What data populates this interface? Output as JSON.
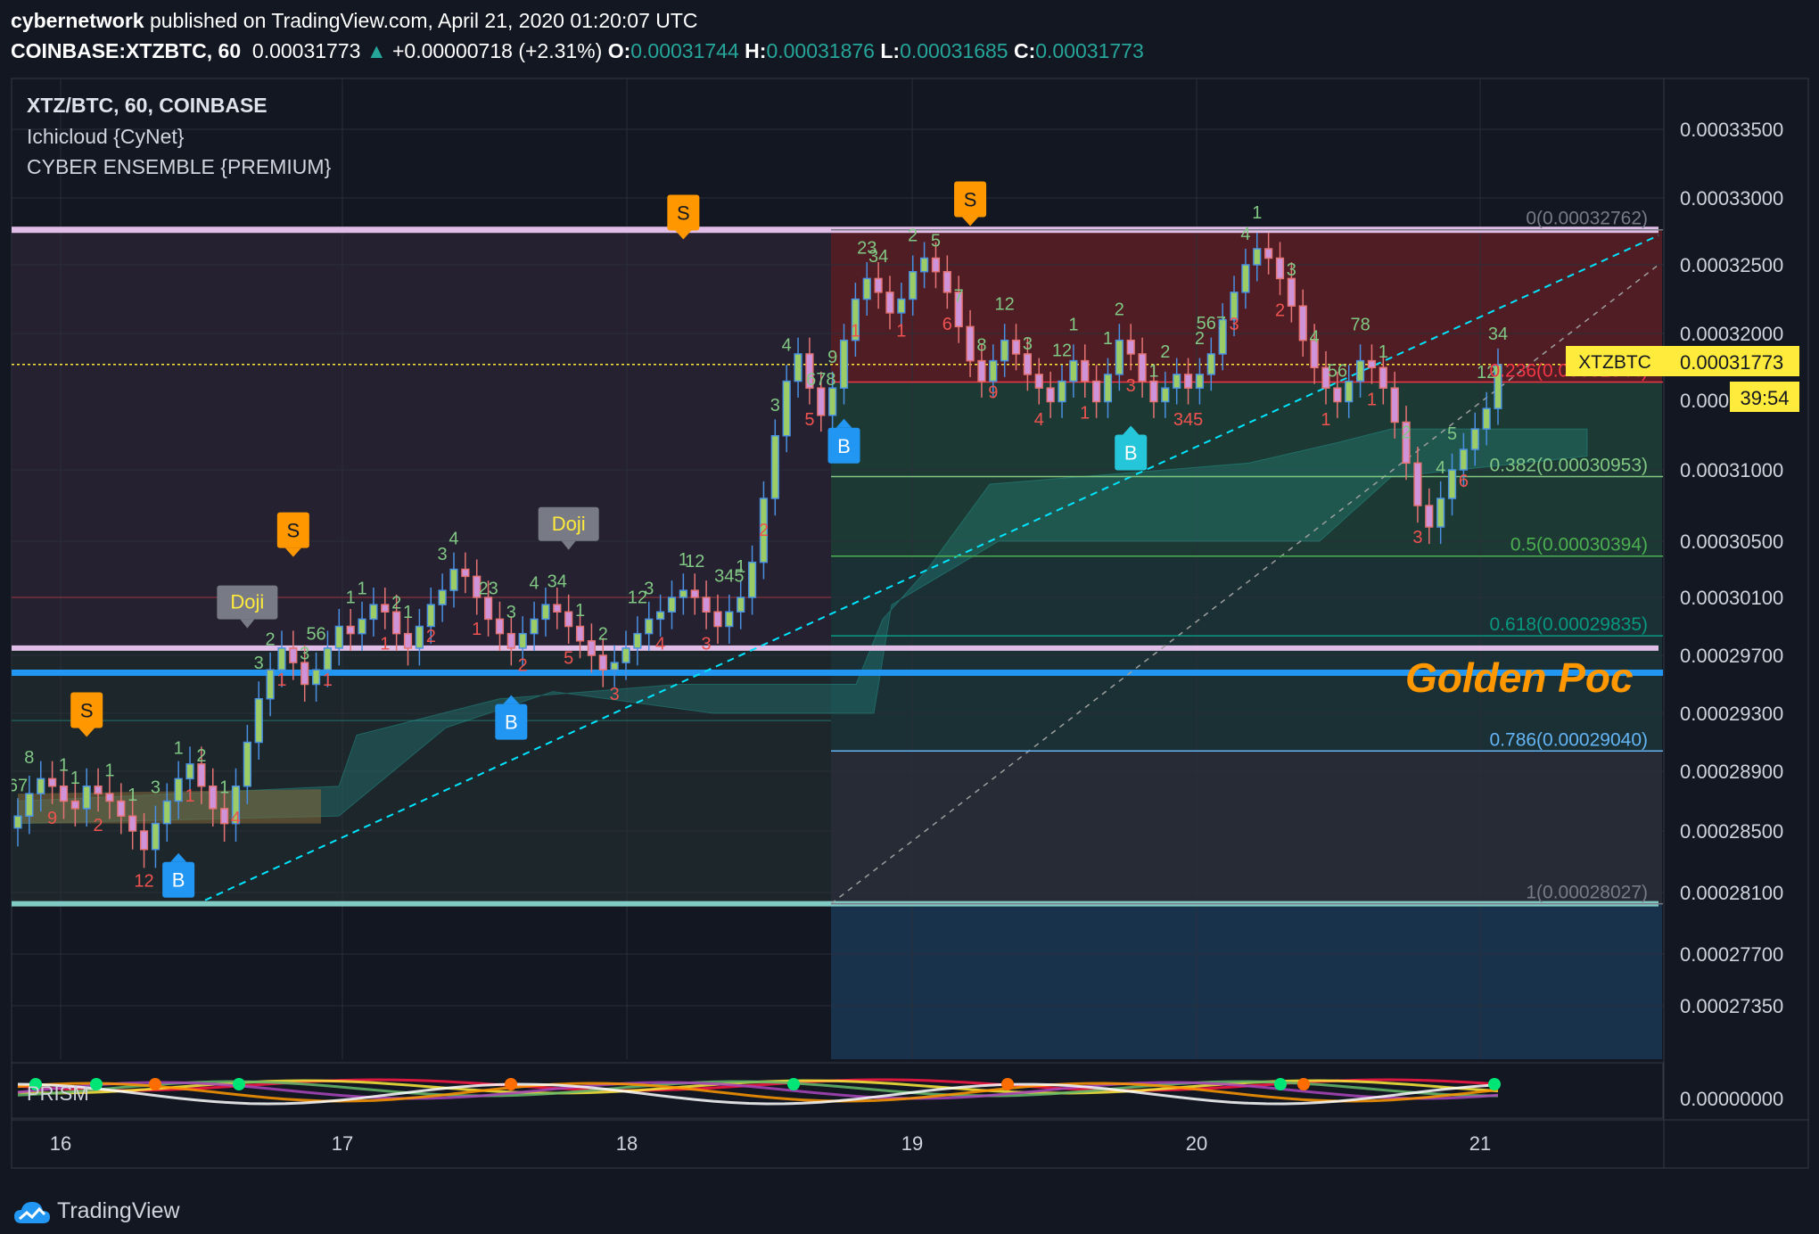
{
  "header": {
    "author": "cybernetwork",
    "published_text": " published on TradingView.com, April 21, 2020 01:20:07 UTC",
    "symbol": "COINBASE:XTZBTC, 60",
    "last_price": "0.00031773",
    "change_arrow": "▲",
    "change": "+0.00000718 (+2.31%)",
    "o_label": "O:",
    "o": "0.00031744",
    "h_label": "H:",
    "h": "0.00031876",
    "l_label": "L:",
    "l": "0.00031685",
    "c_label": "C:",
    "c": "0.00031773"
  },
  "legend": {
    "title": "XTZ/BTC, 60, COINBASE",
    "indicator1": "Ichicloud {CyNet}",
    "indicator2": "CYBER ENSEMBLE {PREMIUM}"
  },
  "price_axis": {
    "ticks": [
      "0.00033500",
      "0.00033000",
      "0.00032500",
      "0.00032000",
      "0.00031000",
      "0.00030500",
      "0.00030100",
      "0.00029700",
      "0.00029300",
      "0.00028900",
      "0.00028500",
      "0.00028100",
      "0.00027700",
      "0.00027350"
    ],
    "tick_values": [
      0.000335,
      0.00033,
      0.000325,
      0.00032,
      0.00031,
      0.000305,
      0.000301,
      0.000297,
      0.000293,
      0.000289,
      0.000285,
      0.000281,
      0.000277,
      0.0002735
    ],
    "partial_tick": "0.000",
    "symbol_tag": "XTZBTC",
    "current_price_tag": "0.00031773",
    "countdown_tag": "39:54",
    "indicator_tick": "0.00000000"
  },
  "time_axis": {
    "labels": [
      "16",
      "17",
      "18",
      "19",
      "20",
      "21"
    ]
  },
  "fib": {
    "levels": [
      {
        "text": "0(0.00032762)",
        "price": 0.00032762,
        "color": "#787b86"
      },
      {
        "text": "0.236(0.00031644)",
        "price": 0.00031644,
        "color": "#f23645"
      },
      {
        "text": "0.382(0.00030953)",
        "price": 0.00030953,
        "color": "#81c784"
      },
      {
        "text": "0.5(0.00030394)",
        "price": 0.00030394,
        "color": "#4caf50"
      },
      {
        "text": "0.618(0.00029835)",
        "price": 0.00029835,
        "color": "#089981"
      },
      {
        "text": "0.786(0.00029040)",
        "price": 0.0002904,
        "color": "#64b5f6"
      },
      {
        "text": "1(0.00028027)",
        "price": 0.00028027,
        "color": "#787b86"
      }
    ]
  },
  "annotations": {
    "golden_pocket": "Golden Poc",
    "prism_label": "PRISM",
    "doji_labels": [
      "Doji",
      "Doji"
    ],
    "sell_labels": [
      "S",
      "S",
      "S",
      "S"
    ],
    "buy_labels": [
      "B",
      "B",
      "B",
      "B",
      "B"
    ],
    "count_labels": [
      "67",
      "8",
      "9",
      "1",
      "1",
      "2",
      "1",
      "1",
      "12",
      "3",
      "1",
      "1",
      "2",
      "1",
      "4",
      "3",
      "2",
      "1",
      "3",
      "56",
      "1",
      "1",
      "1",
      "1",
      "2",
      "1",
      "2",
      "3",
      "4",
      "1",
      "23",
      "3",
      "2",
      "4",
      "34",
      "5",
      "1",
      "2",
      "3",
      "12",
      "3",
      "4",
      "1",
      "12",
      "3",
      "345",
      "1",
      "2",
      "3",
      "4",
      "5",
      "678",
      "9",
      "1",
      "23",
      "34",
      "1",
      "2",
      "5",
      "6",
      "7",
      "8",
      "9",
      "12",
      "3",
      "4",
      "12",
      "1",
      "1",
      "1",
      "2",
      "3",
      "1",
      "2",
      "345",
      "2",
      "567",
      "3",
      "4",
      "1",
      "2",
      "3",
      "4",
      "1",
      "56",
      "78",
      "1",
      "1",
      "2",
      "3",
      "4",
      "5",
      "6",
      "12",
      "34"
    ]
  },
  "watermark": "TradingView",
  "colors": {
    "background": "#131722",
    "up_candle": "#26a69a",
    "down_candle": "#ef5350",
    "current_price": "#ffeb3b",
    "resistance_band": "#e1bee7",
    "support_band": "#80cbc4",
    "golden_pocket_line": "#2196f3",
    "golden_pocket_text": "#ff9800",
    "trend_line": "#00e5ff"
  },
  "chart_data": {
    "type": "candlestick",
    "symbol": "XTZ/BTC",
    "timeframe": "60",
    "exchange": "COINBASE",
    "x_labels": [
      "16",
      "17",
      "18",
      "19",
      "20",
      "21"
    ],
    "ylim": [
      0.0002715,
      0.000338
    ],
    "closes": [
      0.000286,
      0.0002875,
      0.0002885,
      0.000288,
      0.000287,
      0.0002865,
      0.000288,
      0.0002875,
      0.000287,
      0.000286,
      0.000285,
      0.0002838,
      0.0002855,
      0.000287,
      0.0002885,
      0.0002895,
      0.000288,
      0.0002865,
      0.0002855,
      0.000288,
      0.000291,
      0.000294,
      0.000296,
      0.0002975,
      0.0002965,
      0.000295,
      0.000296,
      0.0002975,
      0.000299,
      0.0002985,
      0.0002995,
      0.0003005,
      0.0003,
      0.0002985,
      0.0002975,
      0.000299,
      0.0003005,
      0.0003015,
      0.000303,
      0.0003025,
      0.000301,
      0.0002995,
      0.0002985,
      0.0002975,
      0.0002985,
      0.0002995,
      0.0003005,
      0.0003,
      0.000299,
      0.000298,
      0.000297,
      0.000296,
      0.0002965,
      0.0002975,
      0.0002985,
      0.0002995,
      0.0003,
      0.000301,
      0.0003015,
      0.000301,
      0.0003,
      0.000299,
      0.0003,
      0.000301,
      0.0003035,
      0.000308,
      0.0003125,
      0.0003165,
      0.0003185,
      0.000316,
      0.000314,
      0.000316,
      0.0003195,
      0.0003225,
      0.000324,
      0.000323,
      0.0003215,
      0.0003225,
      0.0003245,
      0.0003255,
      0.0003245,
      0.000323,
      0.0003205,
      0.000318,
      0.0003165,
      0.000318,
      0.0003195,
      0.0003185,
      0.000317,
      0.000316,
      0.000315,
      0.0003165,
      0.000318,
      0.0003165,
      0.000315,
      0.000317,
      0.0003195,
      0.0003185,
      0.0003165,
      0.000315,
      0.000316,
      0.000317,
      0.000316,
      0.000317,
      0.0003185,
      0.000321,
      0.000323,
      0.000325,
      0.0003262,
      0.0003255,
      0.000324,
      0.000322,
      0.0003195,
      0.0003175,
      0.000316,
      0.000315,
      0.0003165,
      0.000318,
      0.0003175,
      0.000316,
      0.0003135,
      0.0003105,
      0.0003075,
      0.000306,
      0.000308,
      0.00031,
      0.0003115,
      0.000313,
      0.0003145,
      0.0003177
    ],
    "fib_retracement": {
      "high": 0.00032762,
      "low": 0.00028027
    },
    "current_price": 0.00031773
  }
}
